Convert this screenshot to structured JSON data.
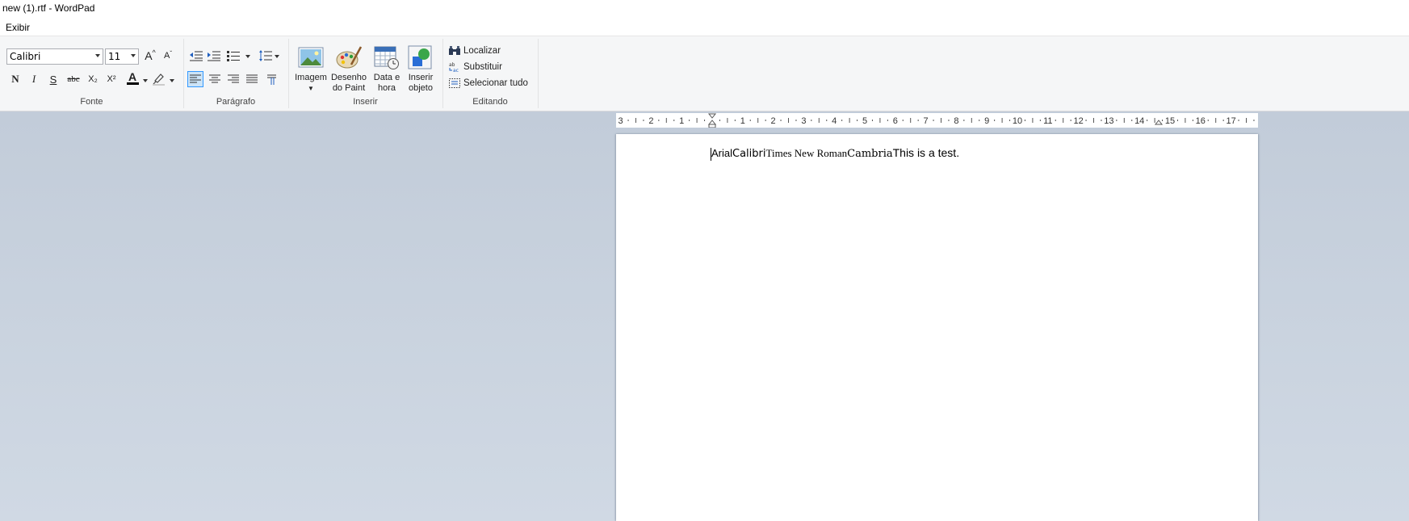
{
  "window": {
    "title": "new (1).rtf - WordPad"
  },
  "menu": {
    "view_label": "Exibir"
  },
  "ribbon": {
    "font_group": {
      "label": "Fonte",
      "font_name": "Calibri",
      "font_size": "11",
      "bold": "N",
      "italic": "I",
      "underline": "S",
      "strikethrough": "abc",
      "subscript": "X₂",
      "superscript": "X²",
      "grow": "A",
      "shrink": "A",
      "color_letter": "A"
    },
    "paragraph_group": {
      "label": "Parágrafo"
    },
    "insert_group": {
      "label": "Inserir",
      "image": "Imagem",
      "paint_line1": "Desenho",
      "paint_line2": "do Paint",
      "datetime_line1": "Data e",
      "datetime_line2": "hora",
      "object_line1": "Inserir",
      "object_line2": "objeto"
    },
    "editing_group": {
      "label": "Editando",
      "find": "Localizar",
      "replace": "Substituir",
      "select_all": "Selecionar tudo"
    }
  },
  "ruler": {
    "numbers": [
      "3",
      "2",
      "1",
      "1",
      "2",
      "3",
      "4",
      "5",
      "6",
      "7",
      "8",
      "9",
      "10",
      "11",
      "12",
      "13",
      "14",
      "15",
      "16",
      "17"
    ],
    "values": [
      -3,
      -2,
      -1,
      1,
      2,
      3,
      4,
      5,
      6,
      7,
      8,
      9,
      10,
      11,
      12,
      13,
      14,
      15,
      16,
      17
    ]
  },
  "document": {
    "runs": [
      {
        "text": "Arial",
        "font": "Liberation Sans"
      },
      {
        "text": "Calibri",
        "font": "DejaVu Sans"
      },
      {
        "text": "Times New Roman",
        "font": "Liberation Serif"
      },
      {
        "text": "Cambria",
        "font": "DejaVu Serif"
      },
      {
        "text": "This is a test.",
        "font": "Liberation Sans"
      }
    ]
  }
}
